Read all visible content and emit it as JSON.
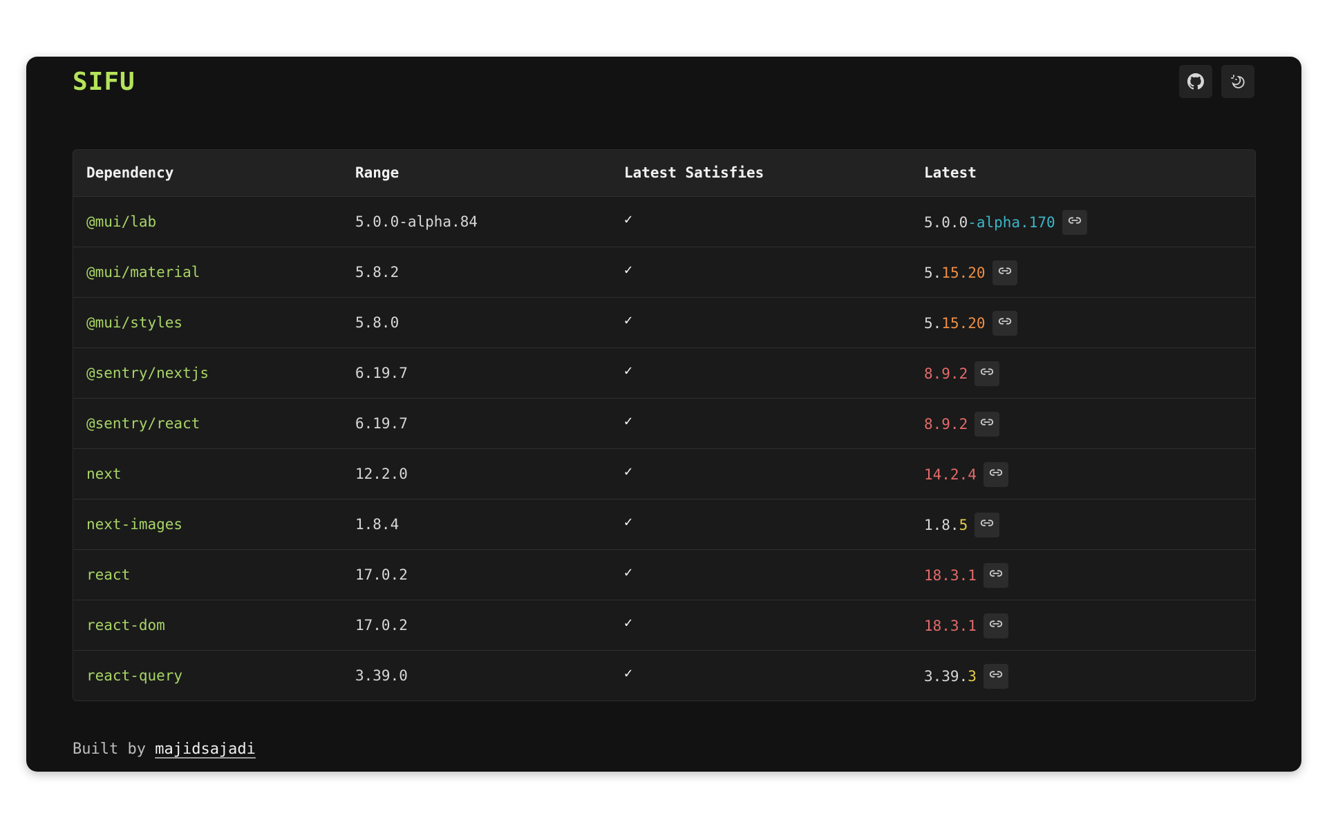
{
  "app": {
    "logo": "SIFU"
  },
  "header": {
    "github_icon": "github-icon",
    "theme_icon": "theme-toggle-icon"
  },
  "table": {
    "columns": [
      "Dependency",
      "Range",
      "Latest Satisfies",
      "Latest"
    ],
    "check_mark": "✓",
    "link_icon": "link-icon",
    "colors": {
      "cyan": "#3cb7c8",
      "orange": "#ef8f45",
      "red": "#e56a6a",
      "yellow": "#e7cc4a",
      "dependency": "#a8d567"
    },
    "rows": [
      {
        "name": "@mui/lab",
        "range": "5.0.0-alpha.84",
        "latest_base": "5.0.0",
        "latest_change": "-alpha.170",
        "change_color": "cyan"
      },
      {
        "name": "@mui/material",
        "range": "5.8.2",
        "latest_base": "5.",
        "latest_change": "15.20",
        "change_color": "orange"
      },
      {
        "name": "@mui/styles",
        "range": "5.8.0",
        "latest_base": "5.",
        "latest_change": "15.20",
        "change_color": "orange"
      },
      {
        "name": "@sentry/nextjs",
        "range": "6.19.7",
        "latest_base": "",
        "latest_change": "8.9.2",
        "change_color": "red"
      },
      {
        "name": "@sentry/react",
        "range": "6.19.7",
        "latest_base": "",
        "latest_change": "8.9.2",
        "change_color": "red"
      },
      {
        "name": "next",
        "range": "12.2.0",
        "latest_base": "",
        "latest_change": "14.2.4",
        "change_color": "red"
      },
      {
        "name": "next-images",
        "range": "1.8.4",
        "latest_base": "1.8.",
        "latest_change": "5",
        "change_color": "yellow"
      },
      {
        "name": "react",
        "range": "17.0.2",
        "latest_base": "",
        "latest_change": "18.3.1",
        "change_color": "red"
      },
      {
        "name": "react-dom",
        "range": "17.0.2",
        "latest_base": "",
        "latest_change": "18.3.1",
        "change_color": "red"
      },
      {
        "name": "react-query",
        "range": "3.39.0",
        "latest_base": "3.39.",
        "latest_change": "3",
        "change_color": "yellow"
      }
    ]
  },
  "footer": {
    "prefix": "Built by",
    "author": "majidsajadi"
  }
}
